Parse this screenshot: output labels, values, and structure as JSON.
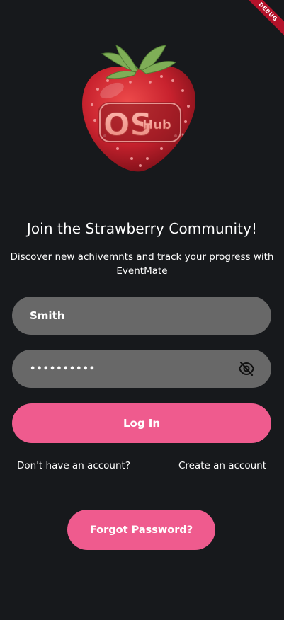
{
  "debug_banner": "DEBUG",
  "logo": {
    "text_main": "OS",
    "text_sub": "Hub"
  },
  "title": "Join the Strawberry Community!",
  "subtitle": "Discover new achivemnts and track your progress with EventMate",
  "username_field": {
    "value": "Smith"
  },
  "password_field": {
    "value": "••••••••••"
  },
  "login_button": "Log In",
  "no_account_text": "Don't have an account?",
  "create_account_link": "Create an account",
  "forgot_password_button": "Forgot Password?",
  "colors": {
    "background": "#17191c",
    "field": "#686868",
    "accent": "#ef5b8e",
    "strawberry": "#d42a36",
    "leaf": "#7fae57"
  },
  "icons": {
    "password_toggle": "eye-off-icon"
  }
}
